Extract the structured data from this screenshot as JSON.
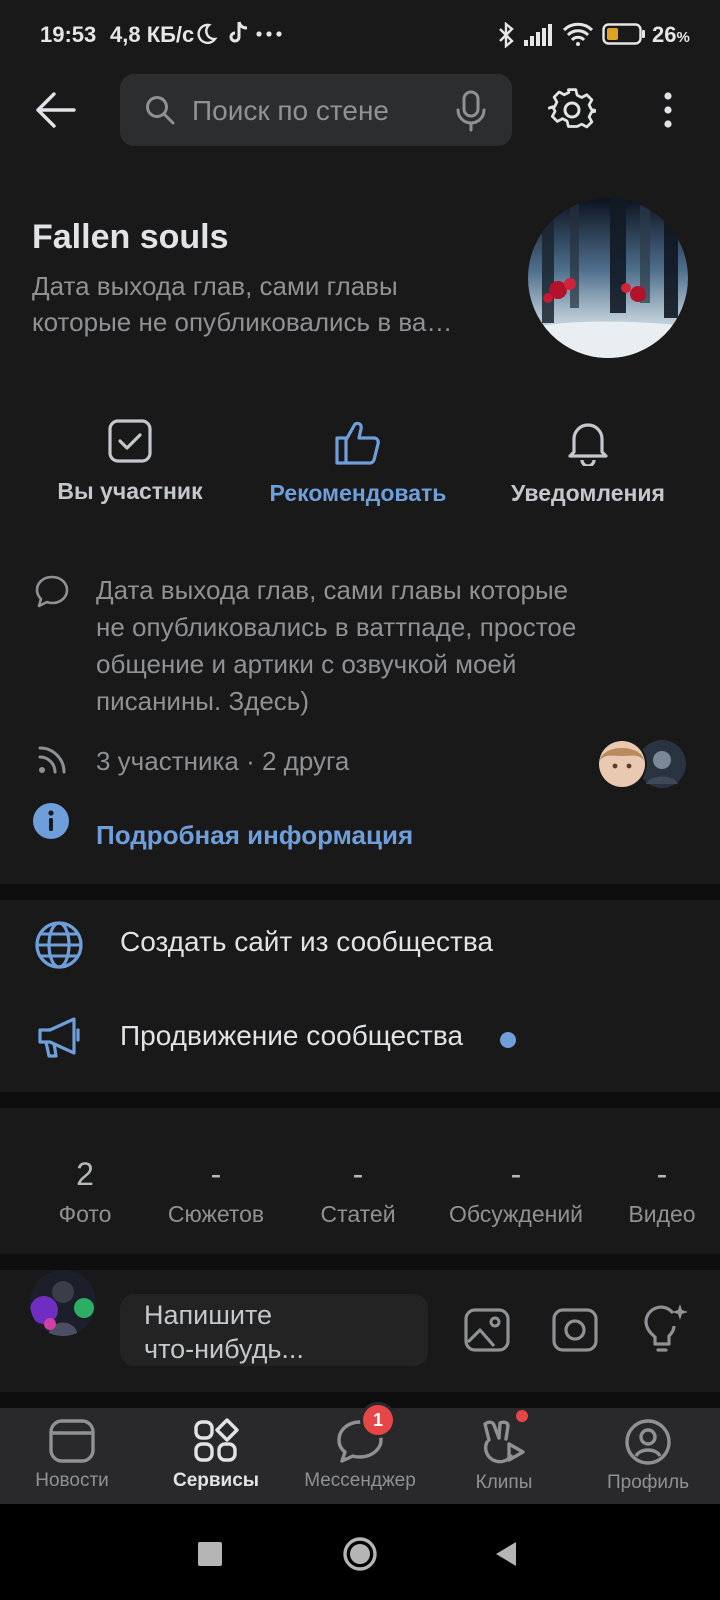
{
  "status_bar": {
    "time": "19:53",
    "speed": "4,8 КБ/с",
    "battery": "26",
    "battery_unit": "%"
  },
  "search": {
    "placeholder": "Поиск по стене"
  },
  "community": {
    "name": "Fallen souls",
    "subtitle_line1": "Дата выхода глав, сами главы",
    "subtitle_line2": "которые не опубликовались в ва…"
  },
  "actions": [
    {
      "label": "Вы участник",
      "icon": "checkbox-icon"
    },
    {
      "label": "Рекомендовать",
      "icon": "thumbs-up-icon"
    },
    {
      "label": "Уведомления",
      "icon": "bell-icon"
    }
  ],
  "description": {
    "line1": "Дата выхода глав, сами главы которые",
    "line2": "не опубликовались в ваттпаде, простое",
    "line3": "общение и артики с озвучкой моей",
    "line4": "писанины. Здесь)"
  },
  "members": {
    "text": "3 участника · 2 друга"
  },
  "more_info": {
    "label": "Подробная информация"
  },
  "services": [
    {
      "label": "Создать сайт из сообщества",
      "icon": "globe-icon"
    },
    {
      "label": "Продвижение сообщества",
      "icon": "megaphone-icon"
    }
  ],
  "counters": [
    {
      "value": "2",
      "label": "Фото"
    },
    {
      "value": "-",
      "label": "Сюжетов"
    },
    {
      "value": "-",
      "label": "Статей"
    },
    {
      "value": "-",
      "label": "Обсуждений"
    },
    {
      "value": "-",
      "label": "Видео"
    }
  ],
  "composer": {
    "line1": "Напишите",
    "line2": "что-нибудь..."
  },
  "tabs": [
    {
      "label": "Новости",
      "icon": "news-icon"
    },
    {
      "label": "Сервисы",
      "icon": "services-icon",
      "active": true
    },
    {
      "label": "Мессенджер",
      "icon": "messenger-icon",
      "badge": "1"
    },
    {
      "label": "Клипы",
      "icon": "clips-icon"
    },
    {
      "label": "Профиль",
      "icon": "profile-icon"
    }
  ],
  "colors": {
    "accent": "#6f9fdb",
    "badge": "#e64646",
    "background": "#19191a"
  }
}
